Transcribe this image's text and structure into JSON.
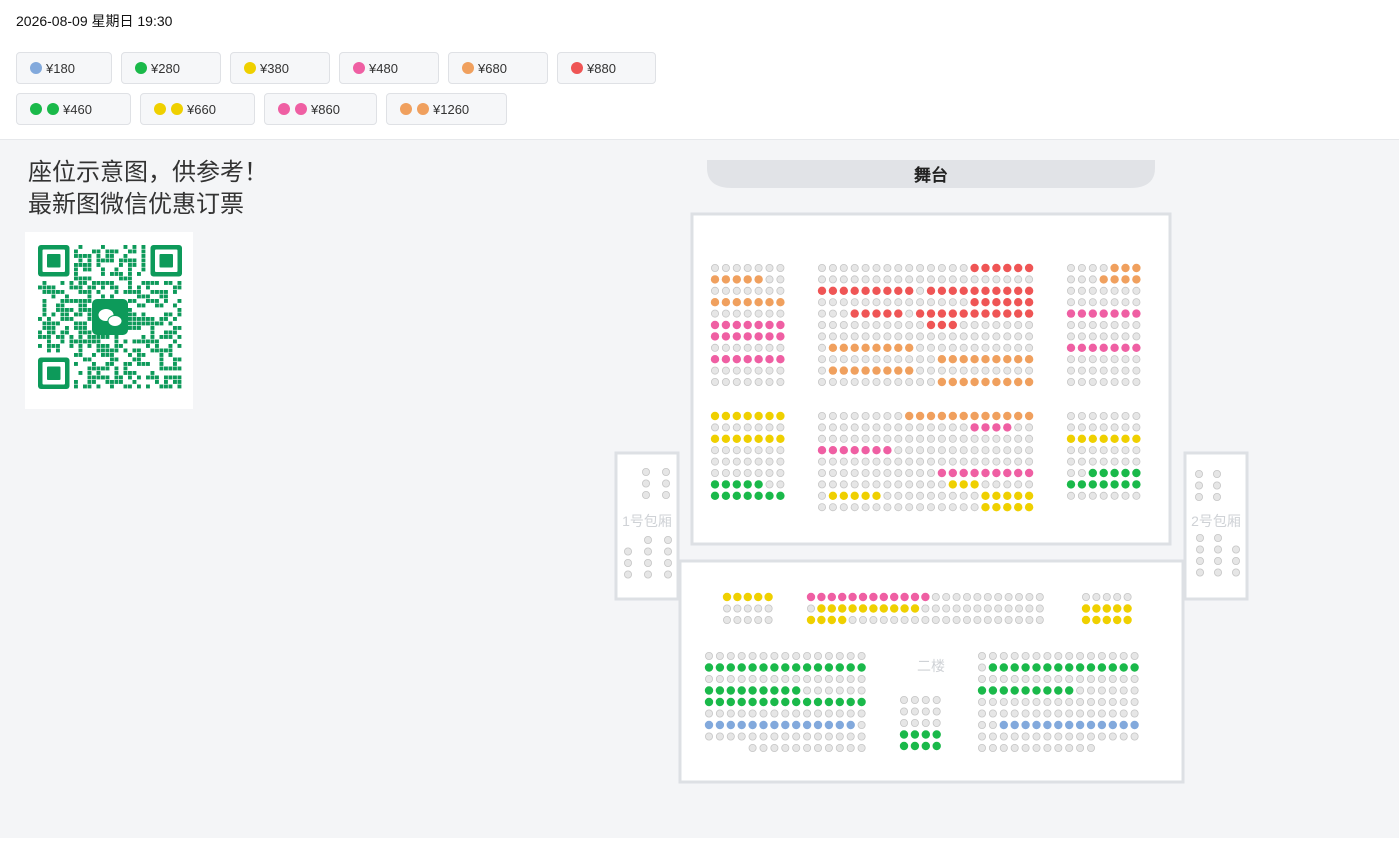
{
  "header": {
    "datetime": "2026-08-09 星期日 19:30"
  },
  "prices_row1": [
    {
      "label": "¥180",
      "colors": [
        "#82a9dc"
      ]
    },
    {
      "label": "¥280",
      "colors": [
        "#1ab94a"
      ]
    },
    {
      "label": "¥380",
      "colors": [
        "#efd000"
      ]
    },
    {
      "label": "¥480",
      "colors": [
        "#ef5fa3"
      ]
    },
    {
      "label": "¥680",
      "colors": [
        "#f0a05e"
      ]
    },
    {
      "label": "¥880",
      "colors": [
        "#ef5555"
      ]
    }
  ],
  "prices_row2": [
    {
      "label": "¥460",
      "colors": [
        "#1ab94a",
        "#1ab94a"
      ]
    },
    {
      "label": "¥660",
      "colors": [
        "#efd000",
        "#efd000"
      ]
    },
    {
      "label": "¥860",
      "colors": [
        "#ef5fa3",
        "#ef5fa3"
      ]
    },
    {
      "label": "¥1260",
      "colors": [
        "#f0a05e",
        "#f0a05e"
      ]
    }
  ],
  "promo": {
    "line1": "座位示意图，供参考！",
    "line2": "最新图微信优惠订票"
  },
  "qr": {
    "icon": "wechat-qr-code",
    "color": "#0d9a5a"
  },
  "seatmap": {
    "stage_label": "舞台",
    "box1_label": "1号包厢",
    "box2_label": "2号包厢",
    "floor2_label": "二楼",
    "colors": {
      "G": "#e6e6e6",
      "A": "#82a9dc",
      "N": "#1ab94a",
      "Y": "#efd000",
      "P": "#ef5fa3",
      "O": "#f0a05e",
      "R": "#ef5555"
    }
  }
}
